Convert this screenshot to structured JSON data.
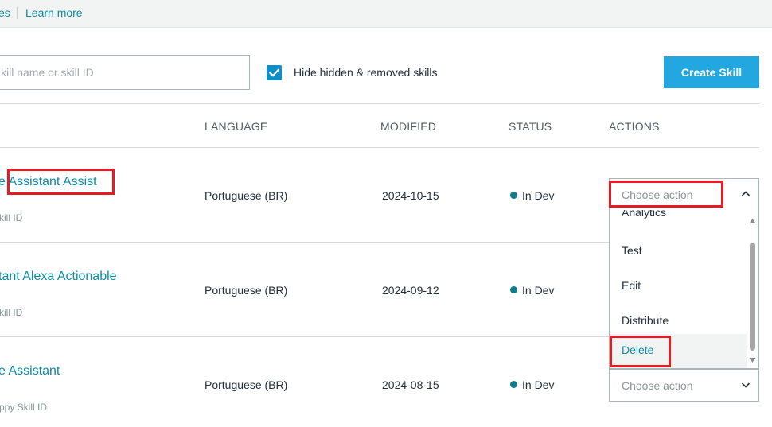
{
  "topbar": {
    "links": [
      "es",
      "Learn more"
    ]
  },
  "search": {
    "placeholder": "kill name or skill ID"
  },
  "filter": {
    "checked": true,
    "label": "Hide hidden & removed skills"
  },
  "create_button": "Create Skill",
  "columns": {
    "language": "LANGUAGE",
    "modified": "MODIFIED",
    "status": "STATUS",
    "actions": "ACTIONS"
  },
  "rows": [
    {
      "name": "e Assistant Assist",
      "skill_id": "kill ID",
      "language": "Portuguese (BR)",
      "modified": "2024-10-15",
      "status": "In Dev",
      "action_placeholder": "Choose action"
    },
    {
      "name": "tant Alexa Actionable",
      "skill_id": "kill ID",
      "language": "Portuguese (BR)",
      "modified": "2024-09-12",
      "status": "In Dev"
    },
    {
      "name": "e Assistant",
      "skill_id": "ppy Skill ID",
      "language": "Portuguese (BR)",
      "modified": "2024-08-15",
      "status": "In Dev",
      "action_placeholder": "Choose action"
    }
  ],
  "action_menu": {
    "items": [
      "Analytics",
      "Test",
      "Edit",
      "Distribute",
      "Delete"
    ],
    "highlighted": "Delete"
  },
  "colors": {
    "link": "#0a8ea3",
    "button": "#22a7e0",
    "checkbox": "#0c8ec8",
    "status_dot": "#0f7a8a",
    "annotation": "#e51c23"
  }
}
